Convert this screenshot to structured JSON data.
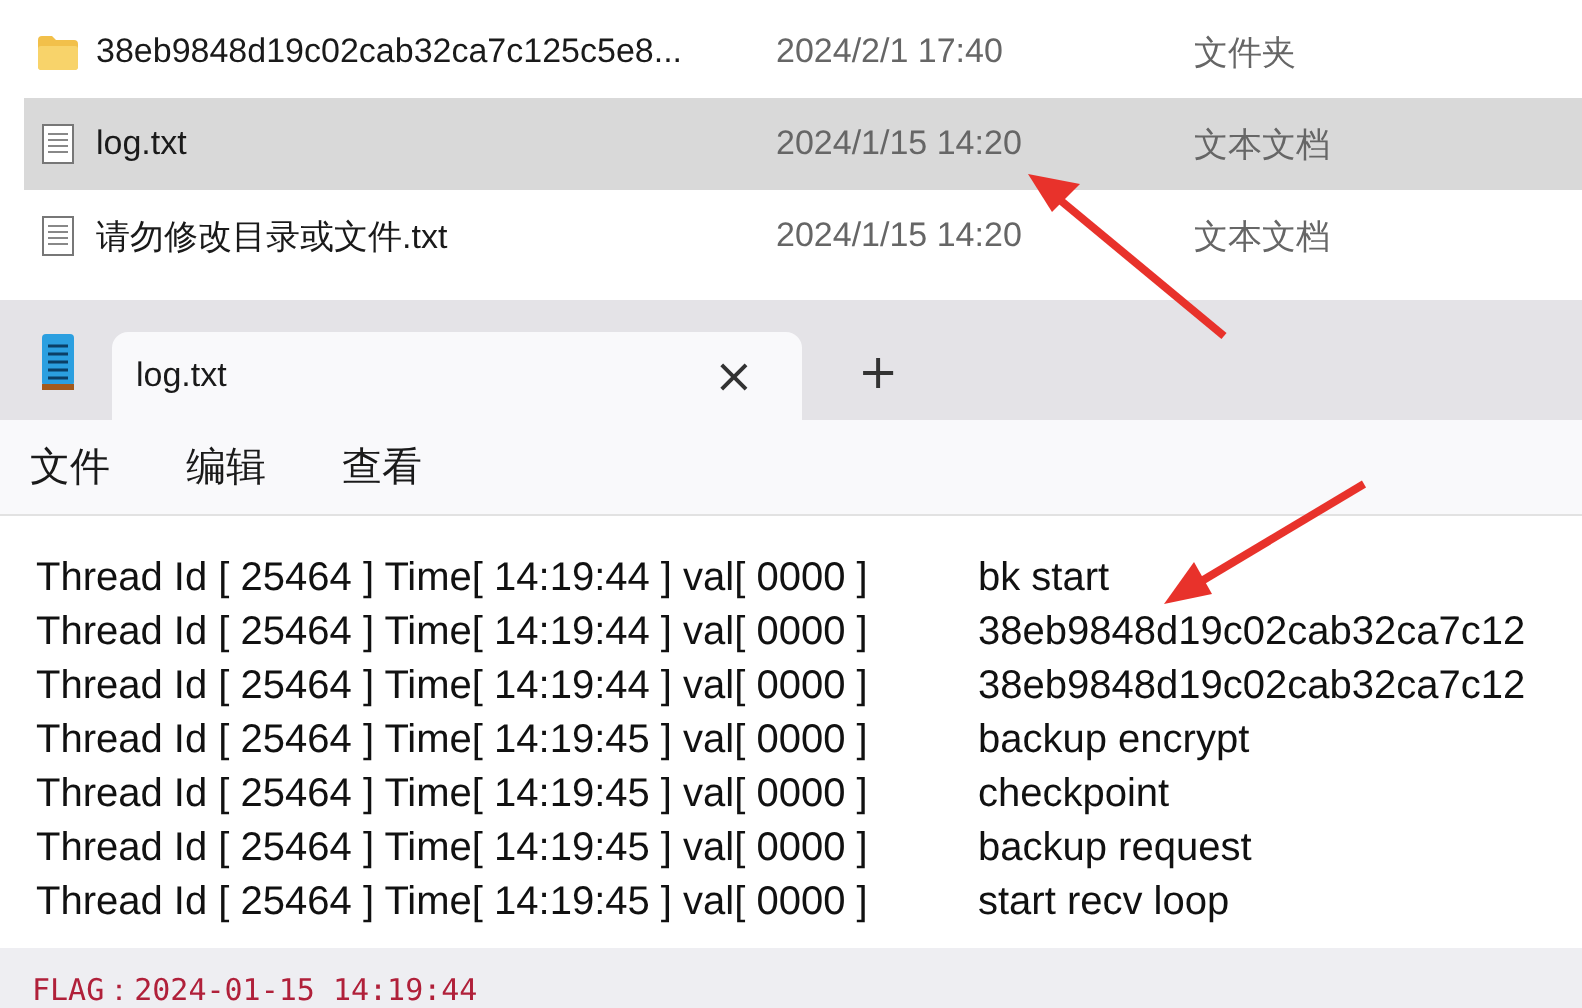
{
  "files": [
    {
      "kind": "folder",
      "name": "38eb9848d19c02cab32ca7c125c5e8...",
      "modified": "2024/2/1 17:40",
      "type": "文件夹",
      "selected": false
    },
    {
      "kind": "text",
      "name": "log.txt",
      "modified": "2024/1/15 14:20",
      "type": "文本文档",
      "selected": true
    },
    {
      "kind": "text",
      "name": "请勿修改目录或文件.txt",
      "modified": "2024/1/15 14:20",
      "type": "文本文档",
      "selected": false
    }
  ],
  "notepad": {
    "tab": {
      "title": "log.txt",
      "close": "×"
    },
    "new_tab": "+",
    "menu": [
      "文件",
      "编辑",
      "查看"
    ],
    "lines": [
      {
        "prefix": "Thread Id [ 25464 ] Time[ 14:19:44 ] val[ 0000 ]",
        "message": "bk start"
      },
      {
        "prefix": "Thread Id [ 25464 ] Time[ 14:19:44 ] val[ 0000 ]",
        "message": "38eb9848d19c02cab32ca7c12"
      },
      {
        "prefix": "Thread Id [ 25464 ] Time[ 14:19:44 ] val[ 0000 ]",
        "message": "38eb9848d19c02cab32ca7c12"
      },
      {
        "prefix": "Thread Id [ 25464 ] Time[ 14:19:45 ] val[ 0000 ]",
        "message": "backup encrypt"
      },
      {
        "prefix": "Thread Id [ 25464 ] Time[ 14:19:45 ] val[ 0000 ]",
        "message": "checkpoint"
      },
      {
        "prefix": "Thread Id [ 25464 ] Time[ 14:19:45 ] val[ 0000 ]",
        "message": "backup request"
      },
      {
        "prefix": "Thread Id [ 25464 ] Time[ 14:19:45 ] val[ 0000 ]",
        "message": "start recv loop"
      }
    ]
  },
  "caption": "FLAG：2024-01-15 14:19:44"
}
